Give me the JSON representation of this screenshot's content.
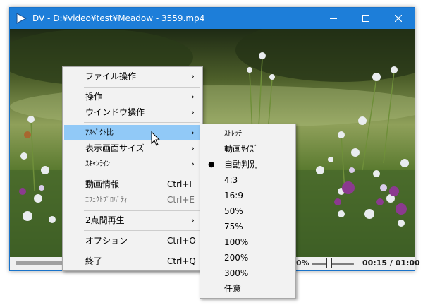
{
  "window": {
    "title": "DV - D:¥video¥test¥Meadow - 3559.mp4",
    "icons": {
      "app": "play-triangle-icon",
      "minimize": "minimize-icon",
      "maximize": "maximize-icon",
      "close": "close-icon"
    }
  },
  "controls": {
    "volume_text": "0%",
    "time_text": "00:15 / 01:00"
  },
  "context_menu": {
    "items": [
      {
        "label": "ファイル操作",
        "arrow": "›"
      },
      {
        "label": "操作",
        "arrow": "›"
      },
      {
        "label": "ウインドウ操作",
        "arrow": "›"
      },
      {
        "label": "ｱｽﾍﾟｸﾄ比",
        "arrow": "›"
      },
      {
        "label": "表示画面サイズ",
        "arrow": "›"
      },
      {
        "label": "ｽｷｬﾝﾗｲﾝ",
        "arrow": "›"
      },
      {
        "label": "動画情報",
        "shortcut": "Ctrl+I"
      },
      {
        "label": "ｴﾌｪｸﾄﾌﾟﾛﾊﾟﾃｨ",
        "shortcut": "Ctrl+E"
      },
      {
        "label": "2点間再生",
        "arrow": "›"
      },
      {
        "label": "オプション",
        "shortcut": "Ctrl+O"
      },
      {
        "label": "終了",
        "shortcut": "Ctrl+Q"
      }
    ],
    "highlighted": "ｱｽﾍﾟｸﾄ比",
    "disabled": "ｴﾌｪｸﾄﾌﾟﾛﾊﾟﾃｨ"
  },
  "aspect_submenu": {
    "items": [
      {
        "label": "ｽﾄﾚｯﾁ"
      },
      {
        "label": "動画ｻｲｽﾞ"
      },
      {
        "label": "自動判別",
        "bullet": "●"
      },
      {
        "label": "4:3"
      },
      {
        "label": "16:9"
      },
      {
        "label": "50%"
      },
      {
        "label": "75%"
      },
      {
        "label": "100%"
      },
      {
        "label": "200%"
      },
      {
        "label": "300%"
      },
      {
        "label": "任意"
      }
    ],
    "selected": "自動判別"
  },
  "colors": {
    "titlebar": "#1d7ed9",
    "menu_highlight": "#91c9f7",
    "menu_bg": "#f2f2f2"
  }
}
